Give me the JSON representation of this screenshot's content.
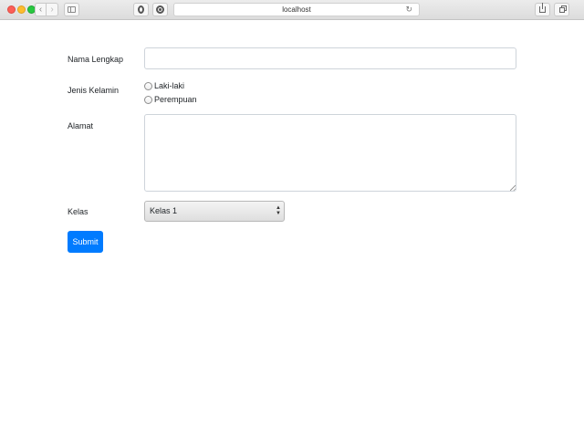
{
  "browser": {
    "address": "localhost",
    "icons": {
      "back": "chevron-left-icon",
      "forward": "chevron-right-icon",
      "sidebar": "sidebar-icon",
      "reload": "reload-icon",
      "share": "share-icon",
      "tabs": "tabs-icon"
    },
    "back_glyph": "‹",
    "forward_glyph": "›",
    "reload_glyph": "↻"
  },
  "form": {
    "name_label": "Nama Lengkap",
    "name_value": "",
    "gender_label": "Jenis Kelamin",
    "gender_options": [
      "Laki-laki",
      "Perempuan"
    ],
    "address_label": "Alamat",
    "address_value": "",
    "class_label": "Kelas",
    "class_selected": "Kelas 1",
    "select_arrows": "▲▼",
    "submit_label": "Submit"
  },
  "colors": {
    "primary": "#007bff",
    "text": "#212529",
    "border": "#ced4da"
  }
}
